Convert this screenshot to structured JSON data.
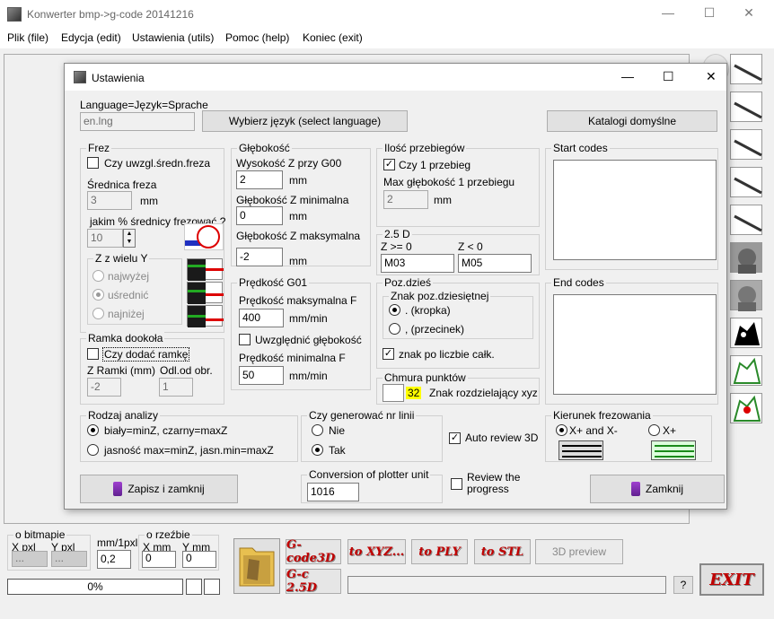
{
  "window": {
    "title": "Konwerter bmp->g-code 20141216",
    "minimize": "—",
    "maximize": "☐",
    "close": "✕"
  },
  "menu": [
    "Plik (file)",
    "Edycja (edit)",
    "Ustawienia (utils)",
    "Pomoc (help)",
    "Koniec (exit)"
  ],
  "dialog": {
    "title": "Ustawienia",
    "minimize": "—",
    "maximize": "☐",
    "close": "✕",
    "language": {
      "label": "Language=Język=Sprache",
      "value": "en.lng",
      "button": "Wybierz język (select language)",
      "defaults": "Katalogi domyślne"
    },
    "frez": {
      "title": "Frez",
      "avg_checkbox": "Czy uwzgl.średn.freza",
      "avg_checked": false,
      "diam_label": "Średnica freza",
      "diam_value": "3",
      "diam_unit": "mm",
      "pct_label": "jakim % średnicy frezować ?",
      "pct_value": "10",
      "z_title": "Z z wielu Y",
      "z_options": [
        "najwyżej",
        "uśrednić",
        "najniżej"
      ],
      "z_selected": 1
    },
    "depth": {
      "title": "Głębokość",
      "z_g00_label": "Wysokość Z przy G00",
      "z_g00": "2",
      "z_min_label": "Głębokość Z minimalna",
      "z_min": "0",
      "z_max_label": "Głębokość Z maksymalna",
      "z_max": "-2",
      "unit": "mm"
    },
    "passes": {
      "title": "Ilość przebiegów",
      "one_pass": "Czy 1 przebieg",
      "one_checked": true,
      "max_label": "Max głębokość 1 przebiegu",
      "max_value": "2",
      "unit": "mm"
    },
    "d25": {
      "title": "2.5 D",
      "z_ge_label": "Z >= 0",
      "z_ge": "M03",
      "z_lt_label": "Z < 0",
      "z_lt": "M05"
    },
    "speed": {
      "title": "Prędkość G01",
      "max_label": "Prędkość maksymalna F",
      "max_value": "400",
      "unit": "mm/min",
      "depth_checkbox": "Uwzględnić głębokość",
      "depth_checked": false,
      "min_label": "Prędkość minimalna F",
      "min_value": "50"
    },
    "decimal": {
      "title": "Poz.dzieś",
      "inner_title": "Znak poz.dziesiętnej",
      "options": [
        ". (kropka)",
        ", (przecinek)"
      ],
      "selected": 0,
      "after_int": "znak po liczbie całk.",
      "after_checked": true
    },
    "cloud": {
      "title": "Chmura punktów",
      "value": "32",
      "label": "Znak rozdzielający xyz"
    },
    "frame": {
      "title": "Ramka dookoła",
      "checkbox": "Czy dodać ramkę",
      "checked": false,
      "z_label": "Z Ramki (mm)",
      "z_value": "-2",
      "off_label": "Odl.od obr.",
      "off_value": "1"
    },
    "analysis": {
      "title": "Rodzaj analizy",
      "options": [
        "biały=minZ, czarny=maxZ",
        "jasność max=minZ, jasn.min=maxZ"
      ],
      "selected": 0
    },
    "lines": {
      "title": "Czy generować nr linii",
      "options": [
        "Nie",
        "Tak"
      ],
      "selected": 1
    },
    "auto_review": {
      "label": "Auto review 3D",
      "checked": true
    },
    "review": {
      "label": "Review the progress",
      "checked": false
    },
    "plotter": {
      "title": "Conversion of plotter unit",
      "value": "1016"
    },
    "start_codes": {
      "title": "Start codes"
    },
    "end_codes": {
      "title": "End codes"
    },
    "direction": {
      "title": "Kierunek frezowania",
      "options": [
        "X+ and X-",
        "X+"
      ],
      "selected": 0
    },
    "save_button": "Zapisz i zamknij",
    "close_button": "Zamknij"
  },
  "bottom": {
    "bitmap": {
      "title": "o bitmapie",
      "x": "X pxl",
      "y": "Y pxl",
      "x_value": "...",
      "y_value": "..."
    },
    "scale": {
      "label": "mm/1pxl",
      "value": "0,2"
    },
    "carving": {
      "title": "o rzeźbie",
      "x": "X mm",
      "y": "Y mm",
      "x_value": "0",
      "y_value": "0"
    },
    "buttons": {
      "gcode3d": "G-code3D",
      "gc25d": "G-c 2.5D",
      "xyz": "to XYZ...",
      "ply": "to PLY",
      "stl": "to STL",
      "preview": "3D preview",
      "exit": "EXIT",
      "help": "?"
    },
    "progress": {
      "text": "0%",
      "fraction": 0
    }
  }
}
